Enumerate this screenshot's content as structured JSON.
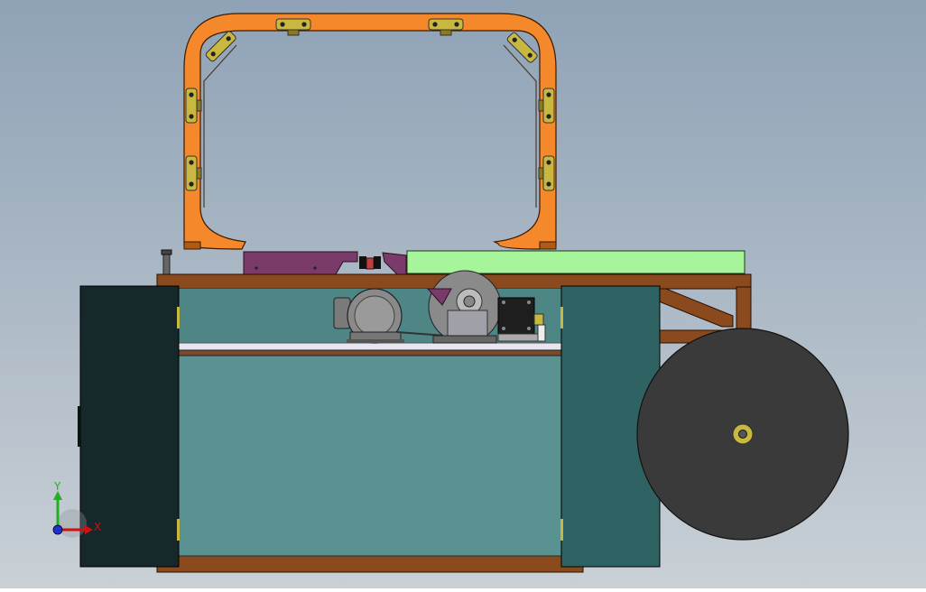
{
  "viewport": {
    "background_top": "#8fa2b6",
    "background_bottom": "#c9d0d6"
  },
  "axis_triad": {
    "x_label": "X",
    "y_label": "Y",
    "x_color": "#d01010",
    "y_color": "#20b020",
    "z_color": "#2030d0"
  },
  "colors": {
    "arch": "#f5882a",
    "arch_outline": "#3a1a00",
    "bracket": "#c8b840",
    "base_frame": "#8b4a1e",
    "cabinet_body": "#5a9292",
    "left_panel": "#16282a",
    "right_panel": "#2f6262",
    "wheel": "#3a3a3a",
    "wheel_hub": "#c8b840",
    "green_block": "#a6f59a",
    "purple_part": "#7a3a6a",
    "motor": "#8a8a8a",
    "stepper": "#1e1e1e",
    "shelf": "#e6e6f0"
  }
}
